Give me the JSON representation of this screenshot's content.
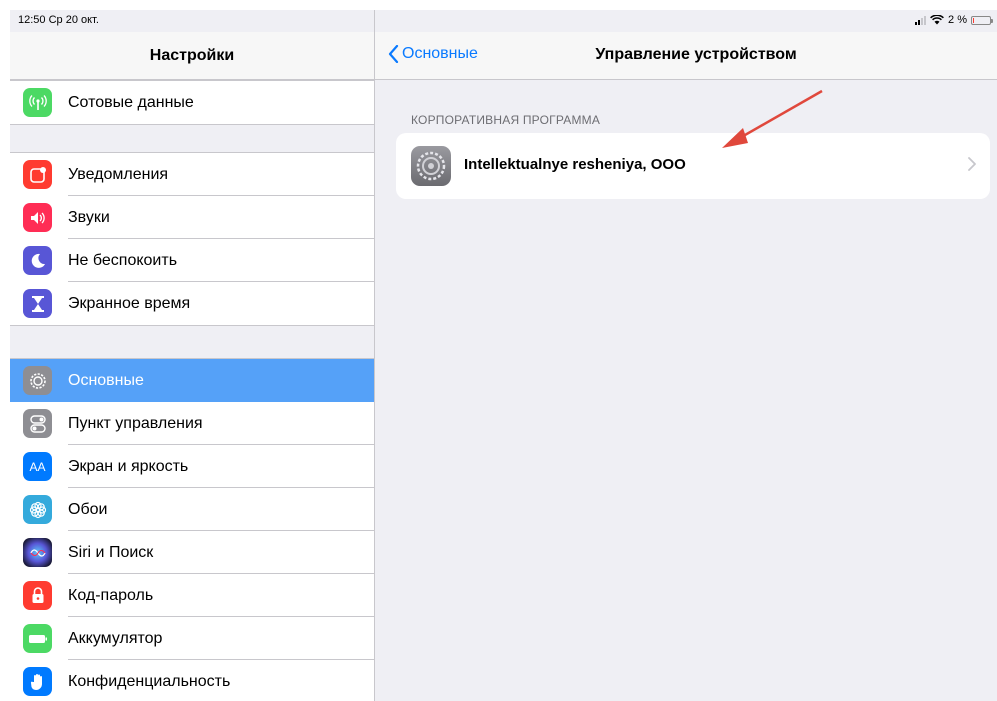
{
  "status_bar": {
    "time_date": "12:50  Ср 20 окт.",
    "battery_percent": "2 %"
  },
  "sidebar": {
    "title": "Настройки",
    "groups": [
      [
        {
          "label": "Сотовые данные",
          "icon": "cellular-icon",
          "color": "#4cd964"
        }
      ],
      [
        {
          "label": "Уведомления",
          "icon": "notifications-icon",
          "color": "#ff3b30"
        },
        {
          "label": "Звуки",
          "icon": "sounds-icon",
          "color": "#ff2d55"
        },
        {
          "label": "Не беспокоить",
          "icon": "moon-icon",
          "color": "#5856d6"
        },
        {
          "label": "Экранное время",
          "icon": "hourglass-icon",
          "color": "#5856d6"
        }
      ],
      [
        {
          "label": "Основные",
          "icon": "gear-icon",
          "color": "#8e8e93",
          "selected": true
        },
        {
          "label": "Пункт управления",
          "icon": "control-center-icon",
          "color": "#8e8e93"
        },
        {
          "label": "Экран и яркость",
          "icon": "display-icon",
          "color": "#007aff",
          "glyph": "AA"
        },
        {
          "label": "Обои",
          "icon": "wallpaper-icon",
          "color": "#34aadc"
        },
        {
          "label": "Siri и Поиск",
          "icon": "siri-icon",
          "color": "#1c1c3c"
        },
        {
          "label": "Код-пароль",
          "icon": "lock-icon",
          "color": "#ff3b30"
        },
        {
          "label": "Аккумулятор",
          "icon": "battery-icon",
          "color": "#4cd964"
        },
        {
          "label": "Конфиденциальность",
          "icon": "hand-icon",
          "color": "#007aff"
        }
      ]
    ]
  },
  "detail": {
    "back_label": "Основные",
    "title": "Управление устройством",
    "section_header": "КОРПОРАТИВНАЯ ПРОГРАММА",
    "profile_name": "Intellektualnye resheniya, OOO"
  },
  "colors": {
    "accent": "#0a7aff",
    "selected_row": "#55a1f8",
    "annotation_arrow": "#e0483c"
  }
}
